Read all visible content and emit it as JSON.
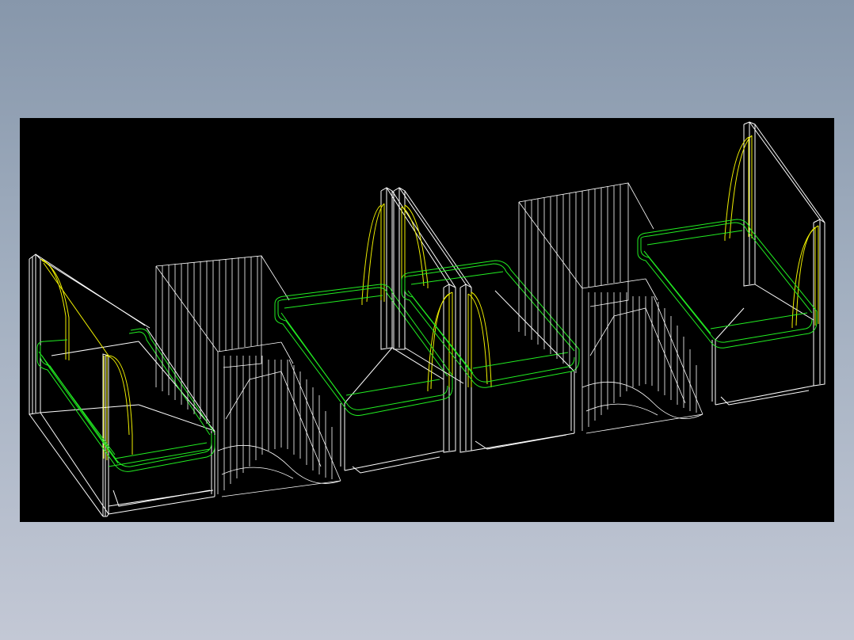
{
  "scene": {
    "description_visible_text": [],
    "background": "#000000",
    "colors": {
      "frame": "#ffffff",
      "seat_cushion": "#22ee22",
      "armrest": "#f0f000",
      "table": "#ffffff"
    },
    "sofas": [
      {
        "id": "left-sofa",
        "armrest": "left"
      },
      {
        "id": "middle-left-sofa",
        "armrest": "right"
      },
      {
        "id": "middle-right-sofa",
        "armrest": "left"
      },
      {
        "id": "right-sofa",
        "armrest": "right"
      }
    ],
    "tables": [
      {
        "id": "left-table"
      },
      {
        "id": "right-table"
      }
    ]
  }
}
